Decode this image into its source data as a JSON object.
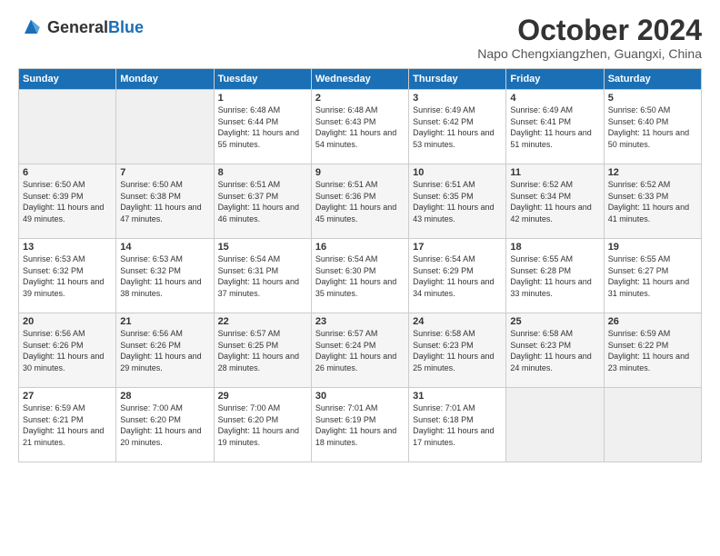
{
  "header": {
    "logo": {
      "general": "General",
      "blue": "Blue"
    },
    "title": "October 2024",
    "location": "Napo Chengxiangzhen, Guangxi, China"
  },
  "weekdays": [
    "Sunday",
    "Monday",
    "Tuesday",
    "Wednesday",
    "Thursday",
    "Friday",
    "Saturday"
  ],
  "weeks": [
    [
      {
        "day": "",
        "empty": true
      },
      {
        "day": "",
        "empty": true
      },
      {
        "day": "1",
        "sunrise": "6:48 AM",
        "sunset": "6:44 PM",
        "daylight": "11 hours and 55 minutes."
      },
      {
        "day": "2",
        "sunrise": "6:48 AM",
        "sunset": "6:43 PM",
        "daylight": "11 hours and 54 minutes."
      },
      {
        "day": "3",
        "sunrise": "6:49 AM",
        "sunset": "6:42 PM",
        "daylight": "11 hours and 53 minutes."
      },
      {
        "day": "4",
        "sunrise": "6:49 AM",
        "sunset": "6:41 PM",
        "daylight": "11 hours and 51 minutes."
      },
      {
        "day": "5",
        "sunrise": "6:50 AM",
        "sunset": "6:40 PM",
        "daylight": "11 hours and 50 minutes."
      }
    ],
    [
      {
        "day": "6",
        "sunrise": "6:50 AM",
        "sunset": "6:39 PM",
        "daylight": "11 hours and 49 minutes."
      },
      {
        "day": "7",
        "sunrise": "6:50 AM",
        "sunset": "6:38 PM",
        "daylight": "11 hours and 47 minutes."
      },
      {
        "day": "8",
        "sunrise": "6:51 AM",
        "sunset": "6:37 PM",
        "daylight": "11 hours and 46 minutes."
      },
      {
        "day": "9",
        "sunrise": "6:51 AM",
        "sunset": "6:36 PM",
        "daylight": "11 hours and 45 minutes."
      },
      {
        "day": "10",
        "sunrise": "6:51 AM",
        "sunset": "6:35 PM",
        "daylight": "11 hours and 43 minutes."
      },
      {
        "day": "11",
        "sunrise": "6:52 AM",
        "sunset": "6:34 PM",
        "daylight": "11 hours and 42 minutes."
      },
      {
        "day": "12",
        "sunrise": "6:52 AM",
        "sunset": "6:33 PM",
        "daylight": "11 hours and 41 minutes."
      }
    ],
    [
      {
        "day": "13",
        "sunrise": "6:53 AM",
        "sunset": "6:32 PM",
        "daylight": "11 hours and 39 minutes."
      },
      {
        "day": "14",
        "sunrise": "6:53 AM",
        "sunset": "6:32 PM",
        "daylight": "11 hours and 38 minutes."
      },
      {
        "day": "15",
        "sunrise": "6:54 AM",
        "sunset": "6:31 PM",
        "daylight": "11 hours and 37 minutes."
      },
      {
        "day": "16",
        "sunrise": "6:54 AM",
        "sunset": "6:30 PM",
        "daylight": "11 hours and 35 minutes."
      },
      {
        "day": "17",
        "sunrise": "6:54 AM",
        "sunset": "6:29 PM",
        "daylight": "11 hours and 34 minutes."
      },
      {
        "day": "18",
        "sunrise": "6:55 AM",
        "sunset": "6:28 PM",
        "daylight": "11 hours and 33 minutes."
      },
      {
        "day": "19",
        "sunrise": "6:55 AM",
        "sunset": "6:27 PM",
        "daylight": "11 hours and 31 minutes."
      }
    ],
    [
      {
        "day": "20",
        "sunrise": "6:56 AM",
        "sunset": "6:26 PM",
        "daylight": "11 hours and 30 minutes."
      },
      {
        "day": "21",
        "sunrise": "6:56 AM",
        "sunset": "6:26 PM",
        "daylight": "11 hours and 29 minutes."
      },
      {
        "day": "22",
        "sunrise": "6:57 AM",
        "sunset": "6:25 PM",
        "daylight": "11 hours and 28 minutes."
      },
      {
        "day": "23",
        "sunrise": "6:57 AM",
        "sunset": "6:24 PM",
        "daylight": "11 hours and 26 minutes."
      },
      {
        "day": "24",
        "sunrise": "6:58 AM",
        "sunset": "6:23 PM",
        "daylight": "11 hours and 25 minutes."
      },
      {
        "day": "25",
        "sunrise": "6:58 AM",
        "sunset": "6:23 PM",
        "daylight": "11 hours and 24 minutes."
      },
      {
        "day": "26",
        "sunrise": "6:59 AM",
        "sunset": "6:22 PM",
        "daylight": "11 hours and 23 minutes."
      }
    ],
    [
      {
        "day": "27",
        "sunrise": "6:59 AM",
        "sunset": "6:21 PM",
        "daylight": "11 hours and 21 minutes."
      },
      {
        "day": "28",
        "sunrise": "7:00 AM",
        "sunset": "6:20 PM",
        "daylight": "11 hours and 20 minutes."
      },
      {
        "day": "29",
        "sunrise": "7:00 AM",
        "sunset": "6:20 PM",
        "daylight": "11 hours and 19 minutes."
      },
      {
        "day": "30",
        "sunrise": "7:01 AM",
        "sunset": "6:19 PM",
        "daylight": "11 hours and 18 minutes."
      },
      {
        "day": "31",
        "sunrise": "7:01 AM",
        "sunset": "6:18 PM",
        "daylight": "11 hours and 17 minutes."
      },
      {
        "day": "",
        "empty": true
      },
      {
        "day": "",
        "empty": true
      }
    ]
  ],
  "labels": {
    "sunrise": "Sunrise:",
    "sunset": "Sunset:",
    "daylight": "Daylight:"
  }
}
